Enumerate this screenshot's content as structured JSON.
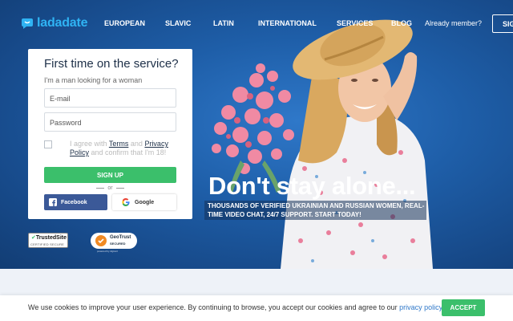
{
  "brand": {
    "name": "ladadate",
    "color": "#2fb3f3"
  },
  "nav": {
    "items": [
      {
        "label": "EUROPEAN"
      },
      {
        "label": "SLAVIC"
      },
      {
        "label": "LATIN"
      },
      {
        "label": "INTERNATIONAL"
      },
      {
        "label": "SERVICES"
      },
      {
        "label": "BLOG"
      }
    ],
    "member_text": "Already member?",
    "signin_label": "SIG"
  },
  "signup": {
    "title": "First time on the service?",
    "subtitle": "I'm a man looking for a woman",
    "email_placeholder": "E-mail",
    "password_placeholder": "Password",
    "agree_prefix": "I agree with",
    "terms_label": "Terms",
    "and": "and",
    "privacy_label": "Privacy Policy",
    "agree_suffix": "and confirm that I'm 18!",
    "signup_label": "SIGN UP",
    "or_label": "or",
    "facebook_label": "Facebook",
    "google_label": "Google"
  },
  "badges": {
    "trusted_title": "TrustedSite",
    "trusted_sub": "CERTIFIED SECURE",
    "geo_title": "GeoTrust",
    "geo_sub": "SECURED",
    "geo_powered": "powered by digicert"
  },
  "hero": {
    "headline": "Don't stay alone...",
    "subline": "THOUSANDS OF VERIFIED UKRAINIAN AND RUSSIAN WOMEN, REAL-TIME VIDEO CHAT, 24/7 SUPPORT. START TODAY!"
  },
  "cookie": {
    "text": "We use cookies to improve your user experience. By continuing to browse, you accept our cookies and agree to our",
    "link": "privacy policy",
    "end": ".",
    "accept_label": "ACCEPT"
  },
  "colors": {
    "accent_green": "#3bbf6b",
    "hero_blue": "#1e5ea8",
    "facebook_blue": "#3b5998"
  },
  "icons": [
    "chat-bubble-logo-icon",
    "facebook-icon",
    "google-icon",
    "checkmark-icon",
    "shield-icon"
  ]
}
